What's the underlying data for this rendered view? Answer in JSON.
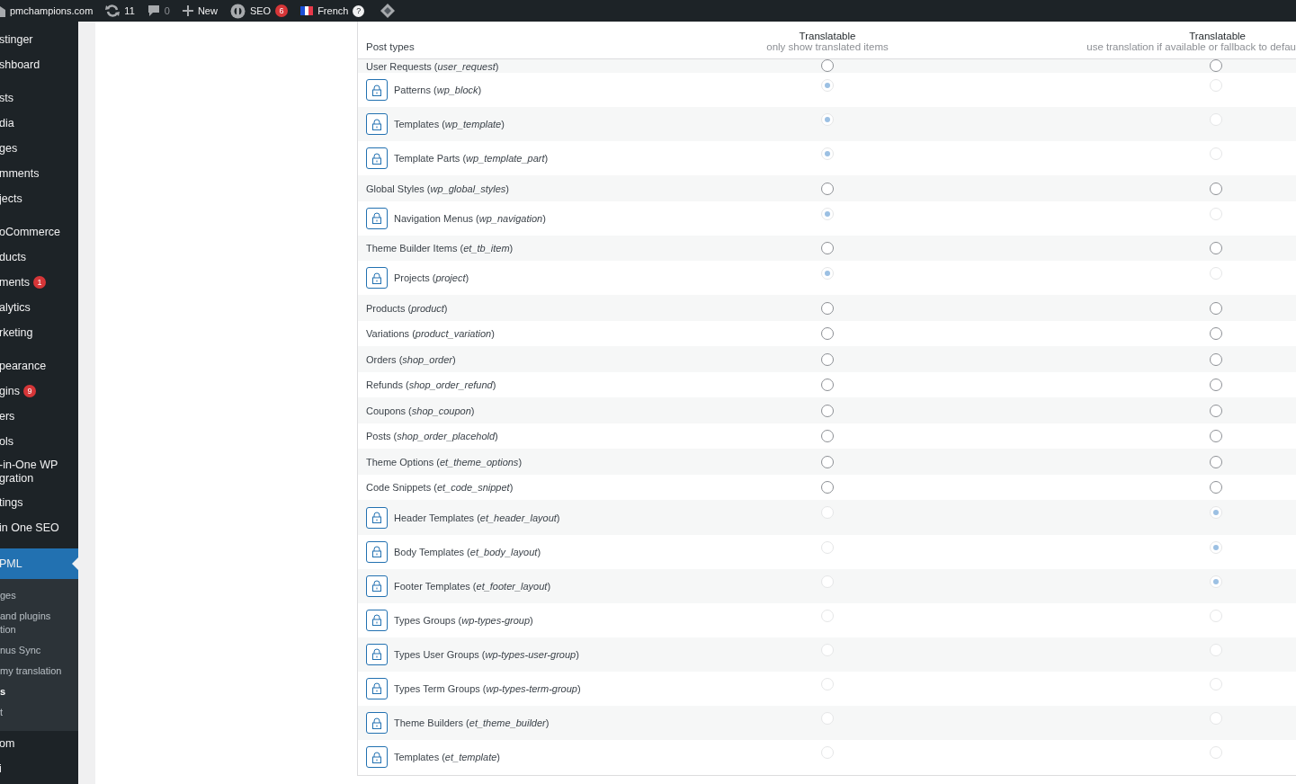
{
  "admin_bar": {
    "site": "pmchampions.com",
    "updates": "11",
    "comments": "0",
    "new": "New",
    "seo": {
      "label": "SEO",
      "badge": "6"
    },
    "language": {
      "label": "French",
      "help": "?"
    }
  },
  "sidebar": {
    "groups": [
      {
        "items": [
          {
            "label": "stinger",
            "current": false
          },
          {
            "label": "shboard",
            "current": false
          }
        ]
      },
      {
        "items": [
          {
            "label": "sts",
            "current": false
          },
          {
            "label": "dia",
            "current": false
          },
          {
            "label": "ges",
            "current": false
          },
          {
            "label": "mments",
            "current": false
          },
          {
            "label": "jects",
            "current": false
          }
        ]
      },
      {
        "items": [
          {
            "label": "oCommerce",
            "current": false
          },
          {
            "label": "ducts",
            "current": false
          },
          {
            "label": "ments",
            "current": false,
            "badge": "1"
          },
          {
            "label": "alytics",
            "current": false
          },
          {
            "label": "rketing",
            "current": false
          }
        ]
      },
      {
        "items": [
          {
            "label": "pearance",
            "current": false
          },
          {
            "label": "gins",
            "current": false,
            "badge": "9"
          },
          {
            "label": "ers",
            "current": false
          },
          {
            "label": "ols",
            "current": false
          },
          {
            "label": "-in-One WP\ngration",
            "current": false
          },
          {
            "label": "tings",
            "current": false
          },
          {
            "label": "in One SEO",
            "current": false
          }
        ]
      },
      {
        "items": [
          {
            "label": "PML",
            "current": true,
            "children": [
              {
                "label": "ges",
                "selected": false
              },
              {
                "label": "and plugins\ntion",
                "selected": false
              },
              {
                "label": "nus Sync",
                "selected": false
              },
              {
                "label": "my translation",
                "selected": false
              },
              {
                "label": "s",
                "selected": true
              },
              {
                "label": "t",
                "selected": false
              }
            ]
          },
          {
            "label": "om",
            "current": false
          },
          {
            "label": "i",
            "current": false
          }
        ]
      }
    ]
  },
  "table": {
    "columns": [
      {
        "title": "Post types"
      },
      {
        "title": "Translatable",
        "subtitle": "only show translated items"
      },
      {
        "title": "Translatable",
        "subtitle": "use translation if available or fallback to defau"
      }
    ],
    "rows": [
      {
        "label": "User Requests (*user_request*)",
        "locked": false,
        "options": [
          {
            "selected": false,
            "disabled": false
          },
          {
            "selected": false,
            "disabled": false
          }
        ]
      },
      {
        "label": "Patterns (*wp_block*)",
        "locked": true,
        "options": [
          {
            "selected": true,
            "disabled": true
          },
          {
            "selected": false,
            "disabled": true
          }
        ]
      },
      {
        "label": "Templates (*wp_template*)",
        "locked": true,
        "options": [
          {
            "selected": true,
            "disabled": true
          },
          {
            "selected": false,
            "disabled": true
          }
        ]
      },
      {
        "label": "Template Parts (*wp_template_part*)",
        "locked": true,
        "options": [
          {
            "selected": true,
            "disabled": true
          },
          {
            "selected": false,
            "disabled": true
          }
        ]
      },
      {
        "label": "Global Styles (*wp_global_styles*)",
        "locked": false,
        "options": [
          {
            "selected": false,
            "disabled": false
          },
          {
            "selected": false,
            "disabled": false
          }
        ]
      },
      {
        "label": "Navigation Menus (*wp_navigation*)",
        "locked": true,
        "options": [
          {
            "selected": true,
            "disabled": true
          },
          {
            "selected": false,
            "disabled": true
          }
        ]
      },
      {
        "label": "Theme Builder Items (*et_tb_item*)",
        "locked": false,
        "options": [
          {
            "selected": false,
            "disabled": false
          },
          {
            "selected": false,
            "disabled": false
          }
        ]
      },
      {
        "label": "Projects (*project*)",
        "locked": true,
        "options": [
          {
            "selected": true,
            "disabled": true
          },
          {
            "selected": false,
            "disabled": true
          }
        ]
      },
      {
        "label": "Products (*product*)",
        "locked": false,
        "options": [
          {
            "selected": false,
            "disabled": false
          },
          {
            "selected": false,
            "disabled": false
          }
        ]
      },
      {
        "label": "Variations (*product_variation*)",
        "locked": false,
        "options": [
          {
            "selected": false,
            "disabled": false
          },
          {
            "selected": false,
            "disabled": false
          }
        ]
      },
      {
        "label": "Orders (*shop_order*)",
        "locked": false,
        "options": [
          {
            "selected": false,
            "disabled": false
          },
          {
            "selected": false,
            "disabled": false
          }
        ]
      },
      {
        "label": "Refunds (*shop_order_refund*)",
        "locked": false,
        "options": [
          {
            "selected": false,
            "disabled": false
          },
          {
            "selected": false,
            "disabled": false
          }
        ]
      },
      {
        "label": "Coupons (*shop_coupon*)",
        "locked": false,
        "options": [
          {
            "selected": false,
            "disabled": false
          },
          {
            "selected": false,
            "disabled": false
          }
        ]
      },
      {
        "label": "Posts (*shop_order_placehold*)",
        "locked": false,
        "options": [
          {
            "selected": false,
            "disabled": false
          },
          {
            "selected": false,
            "disabled": false
          }
        ]
      },
      {
        "label": "Theme Options (*et_theme_options*)",
        "locked": false,
        "options": [
          {
            "selected": false,
            "disabled": false
          },
          {
            "selected": false,
            "disabled": false
          }
        ]
      },
      {
        "label": "Code Snippets (*et_code_snippet*)",
        "locked": false,
        "options": [
          {
            "selected": false,
            "disabled": false
          },
          {
            "selected": false,
            "disabled": false
          }
        ]
      },
      {
        "label": "Header Templates (*et_header_layout*)",
        "locked": true,
        "options": [
          {
            "selected": false,
            "disabled": true
          },
          {
            "selected": true,
            "disabled": true
          }
        ]
      },
      {
        "label": "Body Templates (*et_body_layout*)",
        "locked": true,
        "options": [
          {
            "selected": false,
            "disabled": true
          },
          {
            "selected": true,
            "disabled": true
          }
        ]
      },
      {
        "label": "Footer Templates (*et_footer_layout*)",
        "locked": true,
        "options": [
          {
            "selected": false,
            "disabled": true
          },
          {
            "selected": true,
            "disabled": true
          }
        ]
      },
      {
        "label": "Types Groups (*wp-types-group*)",
        "locked": true,
        "options": [
          {
            "selected": false,
            "disabled": true
          },
          {
            "selected": false,
            "disabled": true
          }
        ]
      },
      {
        "label": "Types User Groups (*wp-types-user-group*)",
        "locked": true,
        "options": [
          {
            "selected": false,
            "disabled": true
          },
          {
            "selected": false,
            "disabled": true
          }
        ]
      },
      {
        "label": "Types Term Groups (*wp-types-term-group*)",
        "locked": true,
        "options": [
          {
            "selected": false,
            "disabled": true
          },
          {
            "selected": false,
            "disabled": true
          }
        ]
      },
      {
        "label": "Theme Builders (*et_theme_builder*)",
        "locked": true,
        "options": [
          {
            "selected": false,
            "disabled": true
          },
          {
            "selected": false,
            "disabled": true
          }
        ]
      },
      {
        "label": "Templates (*et_template*)",
        "locked": true,
        "options": [
          {
            "selected": false,
            "disabled": true
          },
          {
            "selected": false,
            "disabled": true
          }
        ]
      }
    ]
  }
}
